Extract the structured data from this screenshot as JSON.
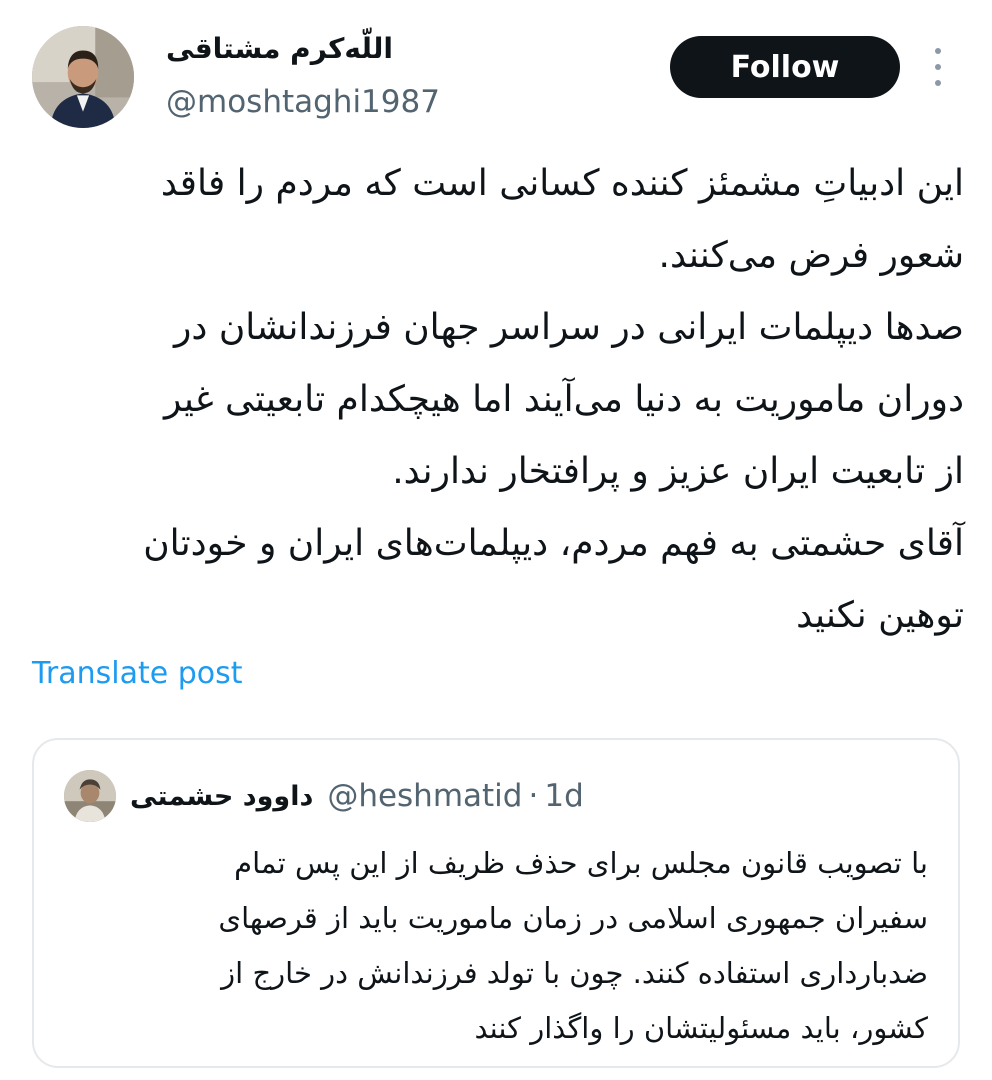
{
  "author": {
    "display_name": "اللّه‌کرم مشتاقی",
    "handle": "@moshtaghi1987",
    "avatar_icon": "profile-photo"
  },
  "header": {
    "follow_label": "Follow",
    "more_icon": "more-vertical-icon"
  },
  "post": {
    "lines": [
      "این ادبیاتِ مشمئز کننده کسانی است که مردم را فاقد",
      "شعور فرض می‌کنند.",
      "صدها دیپلمات ایرانی در سراسر جهان فرزندانشان در",
      "دوران ماموریت به دنیا می‌آیند اما هیچکدام تابعیتی غیر",
      "از تابعیت ایران عزیز و پرافتخار ندارند.",
      "آقای حشمتی به فهم مردم، دیپلمات‌های ایران و خودتان",
      "توهین نکنید"
    ],
    "translate_label": "Translate post"
  },
  "quoted": {
    "display_name": "داوود حشمتی",
    "handle": "@heshmatid",
    "separator": "·",
    "time": "1d",
    "lines": [
      "با تصویب قانون مجلس برای حذف ظریف از این پس تمام",
      "سفیران جمهوری اسلامی در زمان ماموریت باید از قرصهای",
      "ضدبارداری استفاده کنند. چون با تولد فرزندانش در خارج از",
      "کشور، باید مسئولیتشان را واگذار کنند"
    ]
  },
  "colors": {
    "text": "#0f1419",
    "secondary": "#536471",
    "link": "#1d9bf0",
    "button_bg": "#0f1419",
    "border": "#e6e9ec"
  }
}
